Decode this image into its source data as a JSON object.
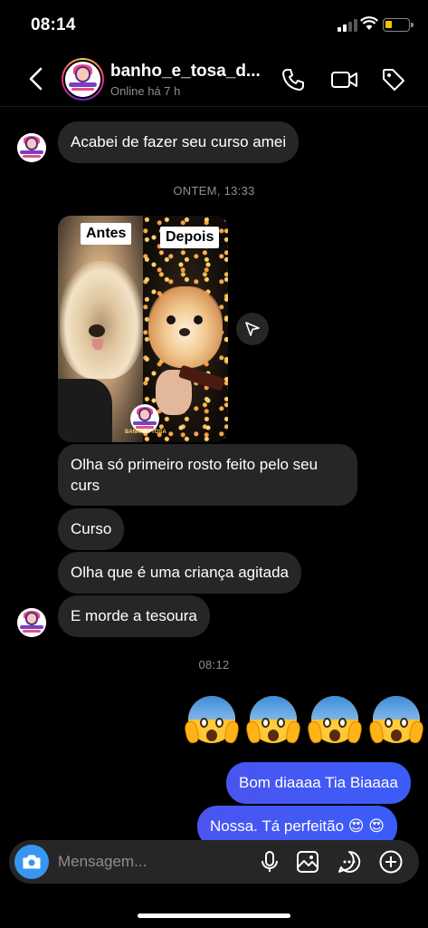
{
  "status_bar": {
    "time": "08:14"
  },
  "header": {
    "username": "banho_e_tosa_d...",
    "status": "Online há 7 h"
  },
  "messages": {
    "m1": "Acabei de fazer seu curso amei",
    "sep1": "ONTEM, 13:33",
    "image": {
      "label_before": "Antes",
      "label_after": "Depois",
      "logo_text": "BANHO E TOSA"
    },
    "m2": "Olha só primeiro rosto feito pelo seu curs",
    "m3": "Curso",
    "m4": "Olha que é uma criança agitada",
    "m5": "E morde a tesoura",
    "sep2": "08:12",
    "emoji_count": 4,
    "out1": "Bom diaaaa Tia Biaaaa",
    "out2": "Nossa. Tá perfeitão 😍 😍"
  },
  "composer": {
    "placeholder": "Mensagem..."
  },
  "colors": {
    "incoming_bubble": "#262626",
    "outgoing_bubble": "#3b5cf8",
    "camera": "#3797f0"
  }
}
